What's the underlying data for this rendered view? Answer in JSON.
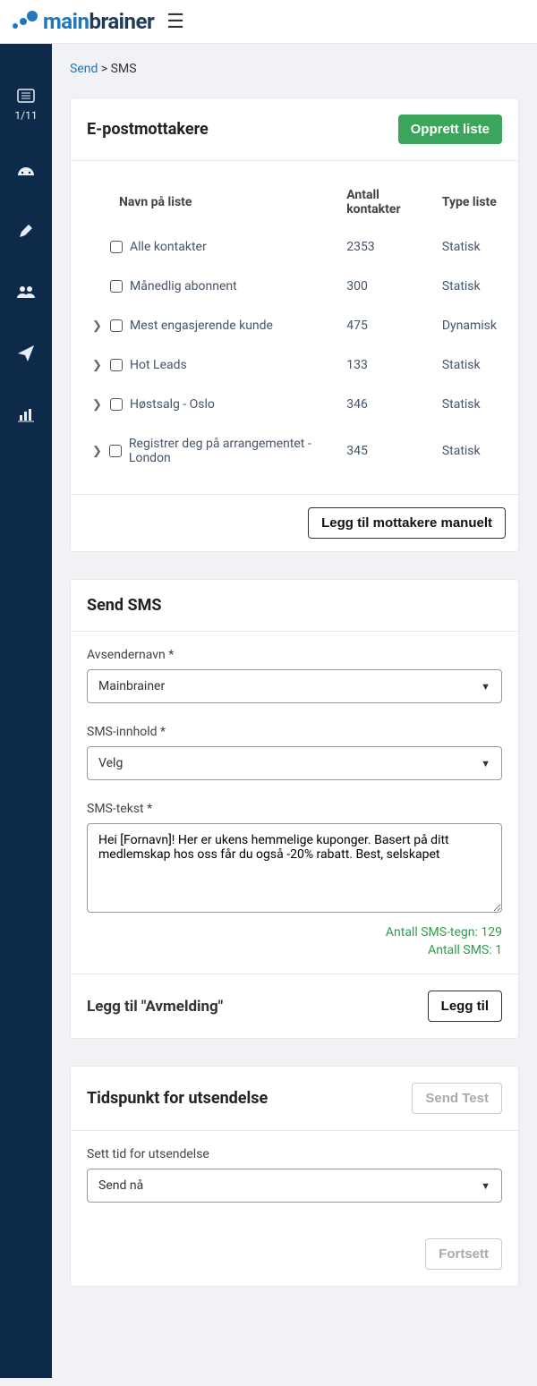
{
  "topbar": {
    "brand_main": "main",
    "brand_brainer": "brainer",
    "menu_icon": "☰"
  },
  "sidebar": {
    "progress_count": "1/11",
    "items": [
      {
        "icon": "list"
      },
      {
        "icon": "gauge"
      },
      {
        "icon": "pencil"
      },
      {
        "icon": "users"
      },
      {
        "icon": "paper-plane"
      },
      {
        "icon": "chart"
      }
    ]
  },
  "breadcrumb": {
    "parent": "Send",
    "sep": " > ",
    "current": "SMS"
  },
  "recipients": {
    "title": "E-postmottakere",
    "create_label": "Opprett liste",
    "cols": {
      "name": "Navn på liste",
      "count": "Antall kontakter",
      "type": "Type liste"
    },
    "rows": [
      {
        "expandable": false,
        "name": "Alle kontakter",
        "count": "2353",
        "type": "Statisk"
      },
      {
        "expandable": false,
        "name": "Månedlig abonnent",
        "count": "300",
        "type": "Statisk"
      },
      {
        "expandable": true,
        "name": "Mest engasjerende kunde",
        "count": "475",
        "type": "Dynamisk"
      },
      {
        "expandable": true,
        "name": "Hot Leads",
        "count": "133",
        "type": "Statisk"
      },
      {
        "expandable": true,
        "name": "Høstsalg - Oslo",
        "count": "346",
        "type": "Statisk"
      },
      {
        "expandable": true,
        "name": "Registrer deg på arrangementet - London",
        "count": "345",
        "type": "Statisk"
      }
    ],
    "add_manual_label": "Legg til mottakere manuelt"
  },
  "sms": {
    "title": "Send SMS",
    "sender_label": "Avsendernavn *",
    "sender_value": "Mainbrainer",
    "content_label": "SMS-innhold *",
    "content_value": "Velg",
    "text_label": "SMS-tekst *",
    "text_value": "Hei [Fornavn]! Her er ukens hemmelige kuponger. Basert på ditt medlemskap hos oss får du også -20% rabatt. Best, selskapet",
    "char_count_label": "Antall SMS-tegn: 129",
    "sms_count_label": "Antall SMS: 1",
    "unsubscribe_title": "Legg til \"Avmelding\"",
    "unsubscribe_btn": "Legg til"
  },
  "schedule": {
    "title": "Tidspunkt for utsendelse",
    "send_test_label": "Send Test",
    "time_label": "Sett tid for utsendelse",
    "time_value": "Send nå",
    "continue_label": "Fortsett"
  }
}
